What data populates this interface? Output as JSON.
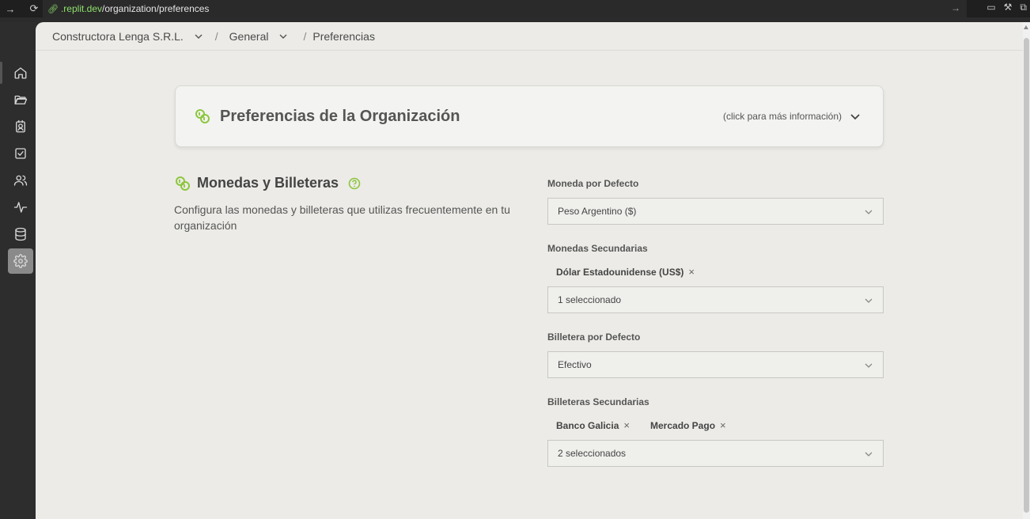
{
  "browser": {
    "url_domain": ".replit.dev",
    "url_path": "/organization/preferences"
  },
  "breadcrumb": {
    "organization": "Constructora Lenga S.R.L.",
    "section": "General",
    "page": "Preferencias",
    "separator": "/"
  },
  "sidebar": {
    "items": [
      {
        "icon": "home-icon"
      },
      {
        "icon": "folder-icon"
      },
      {
        "icon": "contacts-icon"
      },
      {
        "icon": "task-checkbox-icon"
      },
      {
        "icon": "users-icon"
      },
      {
        "icon": "activity-icon"
      },
      {
        "icon": "database-icon"
      },
      {
        "icon": "gear-icon",
        "active": true
      }
    ]
  },
  "info_card": {
    "title": "Preferencias de la Organización",
    "hint": "(click para más información)"
  },
  "section": {
    "title": "Monedas y Billeteras",
    "description": "Configura las monedas y billeteras que utilizas frecuentemente en tu organización"
  },
  "form": {
    "default_currency": {
      "label": "Moneda por Defecto",
      "value": "Peso Argentino ($)"
    },
    "secondary_currencies": {
      "label": "Monedas Secundarias",
      "tags": [
        "Dólar Estadounidense (US$)"
      ],
      "value": "1 seleccionado"
    },
    "default_wallet": {
      "label": "Billetera por Defecto",
      "value": "Efectivo"
    },
    "secondary_wallets": {
      "label": "Billeteras Secundarias",
      "tags": [
        "Banco Galicia",
        "Mercado Pago"
      ],
      "value": "2 seleccionados"
    },
    "remove_glyph": "×"
  },
  "colors": {
    "accent": "#8dc63f",
    "background": "#ecebe7",
    "sidebar": "#2d2d2d"
  }
}
